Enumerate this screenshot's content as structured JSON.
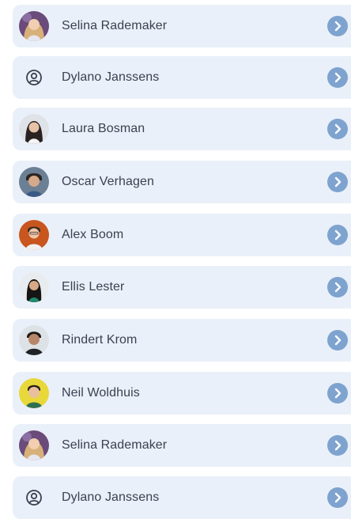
{
  "contacts": [
    {
      "name": "Selina Rademaker",
      "avatar": "photo"
    },
    {
      "name": "Dylano Janssens",
      "avatar": "user-circle-icon"
    },
    {
      "name": "Laura Bosman",
      "avatar": "photo"
    },
    {
      "name": "Oscar Verhagen",
      "avatar": "photo"
    },
    {
      "name": "Alex Boom",
      "avatar": "photo"
    },
    {
      "name": "Ellis Lester",
      "avatar": "photo"
    },
    {
      "name": "Rindert Krom",
      "avatar": "photo"
    },
    {
      "name": "Neil Woldhuis",
      "avatar": "photo"
    },
    {
      "name": "Selina Rademaker",
      "avatar": "photo"
    },
    {
      "name": "Dylano Janssens",
      "avatar": "user-circle-icon"
    }
  ],
  "colors": {
    "row_background": "#eaf0f9",
    "chevron_background": "#7ea3cf",
    "text": "#3a4150"
  }
}
